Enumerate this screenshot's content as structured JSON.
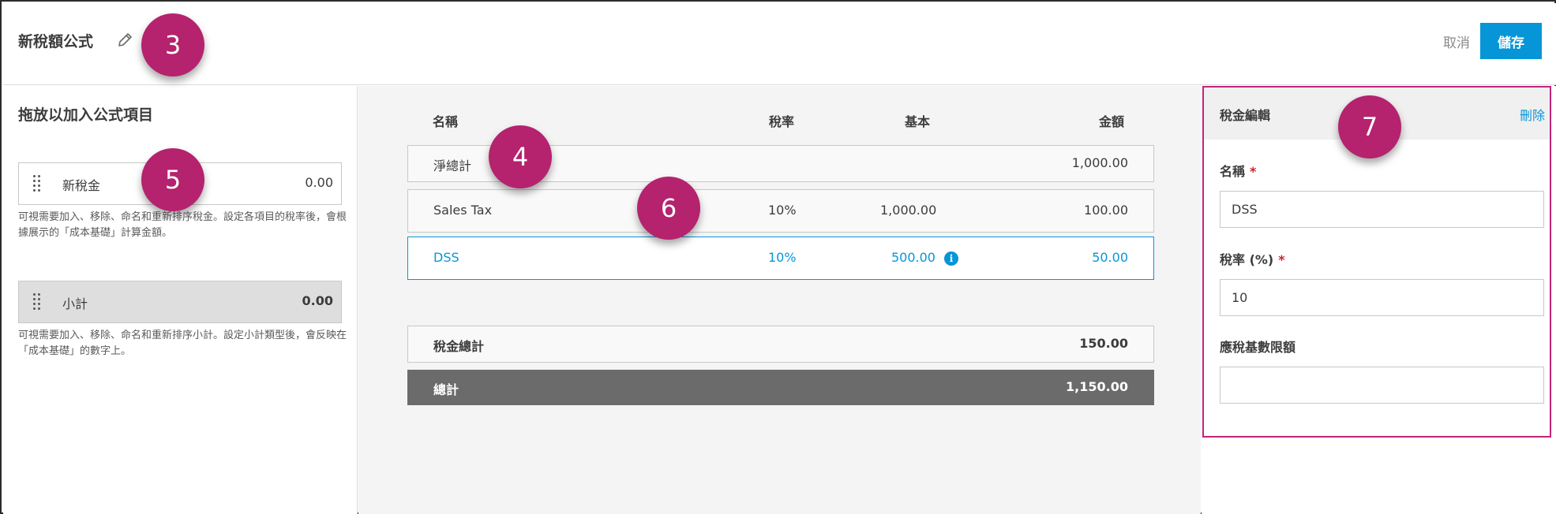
{
  "header": {
    "title": "新稅額公式",
    "edit_icon": "pencil-icon",
    "cancel_label": "取消",
    "save_label": "儲存"
  },
  "callouts": [
    "3",
    "4",
    "5",
    "6",
    "7"
  ],
  "left_panel": {
    "title": "拖放以加入公式項目",
    "new_tax": {
      "label": "新稅金",
      "value": "0.00"
    },
    "new_tax_help": "可視需要加入、移除、命名和重新排序稅金。設定各項目的稅率後，會根據展示的「成本基礎」計算金額。",
    "subtotal": {
      "label": "小計",
      "value": "0.00"
    },
    "subtotal_help": "可視需要加入、移除、命名和重新排序小計。設定小計類型後，會反映在「成本基礎」的數字上。"
  },
  "table": {
    "headers": {
      "name": "名稱",
      "rate": "稅率",
      "base": "基本",
      "amount": "金額"
    },
    "net_total": {
      "name": "淨總計",
      "amount": "1,000.00"
    },
    "rows": [
      {
        "name": "Sales Tax",
        "rate": "10%",
        "base": "1,000.00",
        "amount": "100.00"
      },
      {
        "name": "DSS",
        "rate": "10%",
        "base": "500.00",
        "amount": "50.00",
        "info_icon": "info-icon"
      }
    ],
    "tax_total": {
      "name": "稅金總計",
      "amount": "150.00"
    },
    "grand_total": {
      "name": "總計",
      "amount": "1,150.00"
    }
  },
  "edit_panel": {
    "title": "稅金編輯",
    "delete_label": "刪除",
    "name_label": "名稱",
    "name_value": "DSS",
    "rate_label": "稅率 (%)",
    "rate_value": "10",
    "limit_label": "應稅基數限額",
    "limit_value": ""
  },
  "colors": {
    "accent": "#0696d7",
    "callout": "#b5226e",
    "highlight_border": "#c2247a",
    "required": "#d0202f"
  }
}
